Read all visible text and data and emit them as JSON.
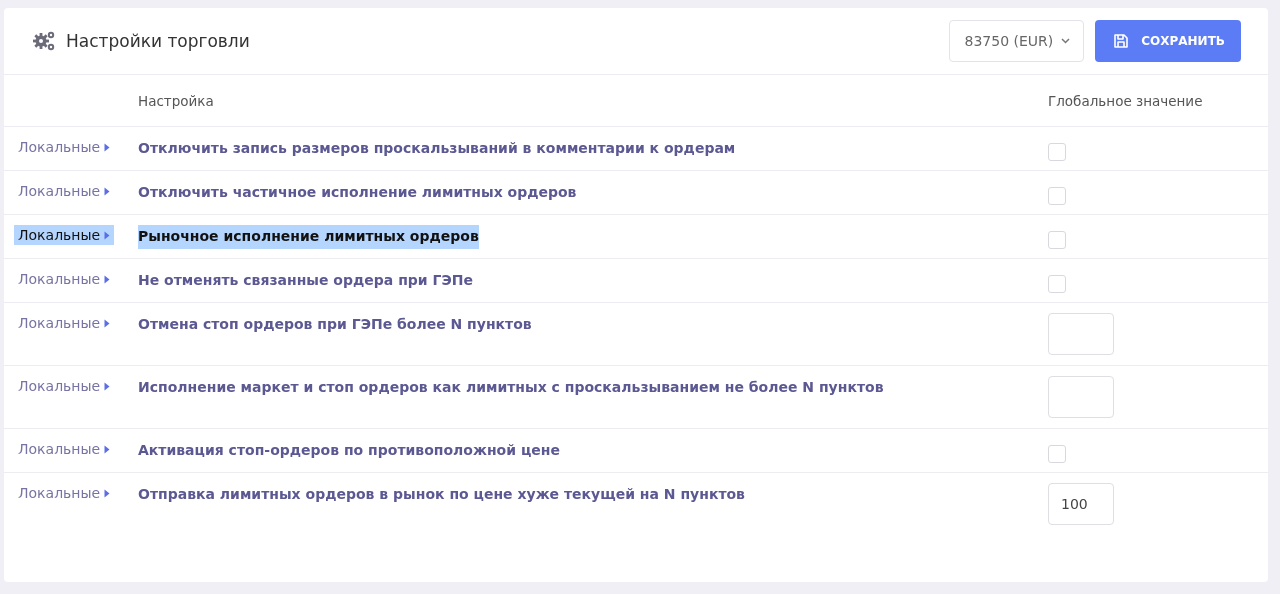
{
  "header": {
    "title": "Настройки торговли",
    "account_select": "83750 (EUR)",
    "save_button": "СОХРАНИТЬ"
  },
  "table": {
    "columns": [
      "Настройка",
      "Глобальное значение"
    ],
    "rows": [
      {
        "local": "Локальные",
        "setting": "Отключить запись размеров проскальзываний в комментарии к ордерам",
        "kind": "checkbox",
        "checked": false,
        "highlighted": false
      },
      {
        "local": "Локальные",
        "setting": "Отключить частичное исполнение лимитных ордеров",
        "kind": "checkbox",
        "checked": false,
        "highlighted": false
      },
      {
        "local": "Локальные",
        "setting": "Рыночное исполнение лимитных ордеров",
        "kind": "checkbox",
        "checked": false,
        "highlighted": true
      },
      {
        "local": "Локальные",
        "setting": "Не отменять связанные ордера при ГЭПе",
        "kind": "checkbox",
        "checked": false,
        "highlighted": false
      },
      {
        "local": "Локальные",
        "setting": "Отмена стоп ордеров при ГЭПе более N пунктов",
        "kind": "number",
        "highlighted": false
      },
      {
        "local": "Локальные",
        "setting": "Исполнение маркет и стоп ордеров как лимитных с проскальзыванием не более N пунктов",
        "kind": "number",
        "highlighted": false
      },
      {
        "local": "Локальные",
        "setting": "Активация стоп-ордеров по противоположной цене",
        "kind": "checkbox",
        "checked": false,
        "highlighted": false
      },
      {
        "local": "Локальные",
        "setting": "Отправка лимитных ордеров в рынок по цене хуже текущей на N пунктов",
        "kind": "number",
        "value": "100",
        "highlighted": false
      }
    ]
  }
}
